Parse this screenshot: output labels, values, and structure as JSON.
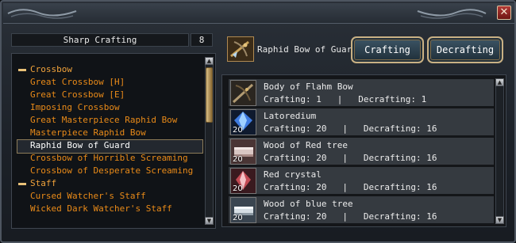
{
  "window": {
    "close_glyph": "✕"
  },
  "left": {
    "category_title": "Sharp Crafting",
    "category_count": "8",
    "items": [
      {
        "label": "Crossbow",
        "kind": "category"
      },
      {
        "label": "Great Crossbow [H]",
        "kind": "item"
      },
      {
        "label": "Great Crossbow [E]",
        "kind": "item"
      },
      {
        "label": "Imposing Crossbow",
        "kind": "item"
      },
      {
        "label": "Great Masterpiece Raphid Bow",
        "kind": "item"
      },
      {
        "label": "Masterpiece Raphid Bow",
        "kind": "item"
      },
      {
        "label": "Raphid Bow of Guard",
        "kind": "item",
        "selected": true
      },
      {
        "label": "Crossbow of Horrible Screaming",
        "kind": "item"
      },
      {
        "label": "Crossbow of Desperate Screaming",
        "kind": "item"
      },
      {
        "label": "Staff",
        "kind": "category"
      },
      {
        "label": "Cursed Watcher's Staff",
        "kind": "item"
      },
      {
        "label": "Wicked Dark Watcher's Staff",
        "kind": "item"
      }
    ]
  },
  "selected": {
    "name": "Raphid Bow of Guard",
    "icon": "crossbow-icon"
  },
  "buttons": {
    "crafting": "Crafting",
    "decrafting": "Decrafting"
  },
  "materials": [
    {
      "name": "Body of Flahm Bow",
      "qty": "",
      "stats": "Crafting: 1   |   Decrafting: 1",
      "icon": "bow-body-icon"
    },
    {
      "name": "Latoredium",
      "qty": "20",
      "stats": "Crafting: 20   |   Decrafting: 16",
      "icon": "blue-crystal-icon"
    },
    {
      "name": "Wood of Red tree",
      "qty": "20",
      "stats": "Crafting: 20   |   Decrafting: 16",
      "icon": "red-wood-icon"
    },
    {
      "name": "Red crystal",
      "qty": "20",
      "stats": "Crafting: 20   |   Decrafting: 16",
      "icon": "red-crystal-icon"
    },
    {
      "name": "Wood of blue tree",
      "qty": "20",
      "stats": "Crafting: 20   |   Decrafting: 16",
      "icon": "blue-wood-icon"
    }
  ],
  "colors": {
    "category_text": "#f0a23b",
    "item_text": "#e98a18",
    "selected_border": "#8d7c59",
    "frame_gold": "#c9b184"
  }
}
